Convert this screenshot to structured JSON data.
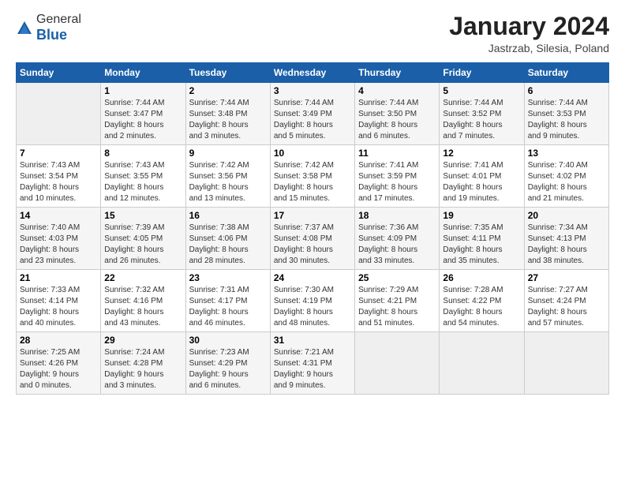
{
  "header": {
    "logo_line1": "General",
    "logo_line2": "Blue",
    "month": "January 2024",
    "location": "Jastrzab, Silesia, Poland"
  },
  "days_of_week": [
    "Sunday",
    "Monday",
    "Tuesday",
    "Wednesday",
    "Thursday",
    "Friday",
    "Saturday"
  ],
  "weeks": [
    [
      {
        "day": "",
        "info": ""
      },
      {
        "day": "1",
        "info": "Sunrise: 7:44 AM\nSunset: 3:47 PM\nDaylight: 8 hours\nand 2 minutes."
      },
      {
        "day": "2",
        "info": "Sunrise: 7:44 AM\nSunset: 3:48 PM\nDaylight: 8 hours\nand 3 minutes."
      },
      {
        "day": "3",
        "info": "Sunrise: 7:44 AM\nSunset: 3:49 PM\nDaylight: 8 hours\nand 5 minutes."
      },
      {
        "day": "4",
        "info": "Sunrise: 7:44 AM\nSunset: 3:50 PM\nDaylight: 8 hours\nand 6 minutes."
      },
      {
        "day": "5",
        "info": "Sunrise: 7:44 AM\nSunset: 3:52 PM\nDaylight: 8 hours\nand 7 minutes."
      },
      {
        "day": "6",
        "info": "Sunrise: 7:44 AM\nSunset: 3:53 PM\nDaylight: 8 hours\nand 9 minutes."
      }
    ],
    [
      {
        "day": "7",
        "info": "Sunrise: 7:43 AM\nSunset: 3:54 PM\nDaylight: 8 hours\nand 10 minutes."
      },
      {
        "day": "8",
        "info": "Sunrise: 7:43 AM\nSunset: 3:55 PM\nDaylight: 8 hours\nand 12 minutes."
      },
      {
        "day": "9",
        "info": "Sunrise: 7:42 AM\nSunset: 3:56 PM\nDaylight: 8 hours\nand 13 minutes."
      },
      {
        "day": "10",
        "info": "Sunrise: 7:42 AM\nSunset: 3:58 PM\nDaylight: 8 hours\nand 15 minutes."
      },
      {
        "day": "11",
        "info": "Sunrise: 7:41 AM\nSunset: 3:59 PM\nDaylight: 8 hours\nand 17 minutes."
      },
      {
        "day": "12",
        "info": "Sunrise: 7:41 AM\nSunset: 4:01 PM\nDaylight: 8 hours\nand 19 minutes."
      },
      {
        "day": "13",
        "info": "Sunrise: 7:40 AM\nSunset: 4:02 PM\nDaylight: 8 hours\nand 21 minutes."
      }
    ],
    [
      {
        "day": "14",
        "info": "Sunrise: 7:40 AM\nSunset: 4:03 PM\nDaylight: 8 hours\nand 23 minutes."
      },
      {
        "day": "15",
        "info": "Sunrise: 7:39 AM\nSunset: 4:05 PM\nDaylight: 8 hours\nand 26 minutes."
      },
      {
        "day": "16",
        "info": "Sunrise: 7:38 AM\nSunset: 4:06 PM\nDaylight: 8 hours\nand 28 minutes."
      },
      {
        "day": "17",
        "info": "Sunrise: 7:37 AM\nSunset: 4:08 PM\nDaylight: 8 hours\nand 30 minutes."
      },
      {
        "day": "18",
        "info": "Sunrise: 7:36 AM\nSunset: 4:09 PM\nDaylight: 8 hours\nand 33 minutes."
      },
      {
        "day": "19",
        "info": "Sunrise: 7:35 AM\nSunset: 4:11 PM\nDaylight: 8 hours\nand 35 minutes."
      },
      {
        "day": "20",
        "info": "Sunrise: 7:34 AM\nSunset: 4:13 PM\nDaylight: 8 hours\nand 38 minutes."
      }
    ],
    [
      {
        "day": "21",
        "info": "Sunrise: 7:33 AM\nSunset: 4:14 PM\nDaylight: 8 hours\nand 40 minutes."
      },
      {
        "day": "22",
        "info": "Sunrise: 7:32 AM\nSunset: 4:16 PM\nDaylight: 8 hours\nand 43 minutes."
      },
      {
        "day": "23",
        "info": "Sunrise: 7:31 AM\nSunset: 4:17 PM\nDaylight: 8 hours\nand 46 minutes."
      },
      {
        "day": "24",
        "info": "Sunrise: 7:30 AM\nSunset: 4:19 PM\nDaylight: 8 hours\nand 48 minutes."
      },
      {
        "day": "25",
        "info": "Sunrise: 7:29 AM\nSunset: 4:21 PM\nDaylight: 8 hours\nand 51 minutes."
      },
      {
        "day": "26",
        "info": "Sunrise: 7:28 AM\nSunset: 4:22 PM\nDaylight: 8 hours\nand 54 minutes."
      },
      {
        "day": "27",
        "info": "Sunrise: 7:27 AM\nSunset: 4:24 PM\nDaylight: 8 hours\nand 57 minutes."
      }
    ],
    [
      {
        "day": "28",
        "info": "Sunrise: 7:25 AM\nSunset: 4:26 PM\nDaylight: 9 hours\nand 0 minutes."
      },
      {
        "day": "29",
        "info": "Sunrise: 7:24 AM\nSunset: 4:28 PM\nDaylight: 9 hours\nand 3 minutes."
      },
      {
        "day": "30",
        "info": "Sunrise: 7:23 AM\nSunset: 4:29 PM\nDaylight: 9 hours\nand 6 minutes."
      },
      {
        "day": "31",
        "info": "Sunrise: 7:21 AM\nSunset: 4:31 PM\nDaylight: 9 hours\nand 9 minutes."
      },
      {
        "day": "",
        "info": ""
      },
      {
        "day": "",
        "info": ""
      },
      {
        "day": "",
        "info": ""
      }
    ]
  ]
}
